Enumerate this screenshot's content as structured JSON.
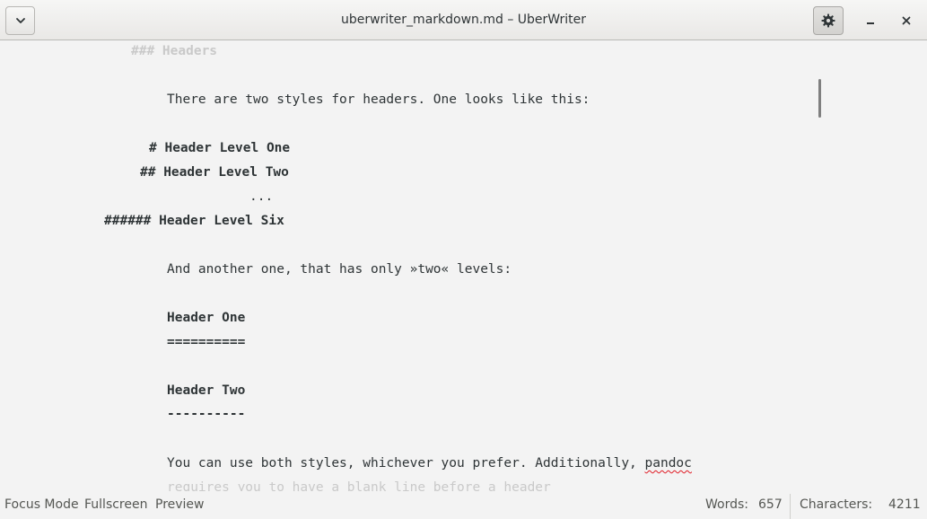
{
  "window": {
    "title": "uberwriter_markdown.md – UberWriter",
    "menu_icon": "chevron-down-icon",
    "settings_icon": "gear-icon",
    "minimize_icon": "minimize-icon",
    "close_icon": "close-icon"
  },
  "editor": {
    "lines": {
      "h3_partial": "### Headers",
      "para1": "There are two styles for headers. One looks like this:",
      "h1_marker": "#",
      "h1_text": "Header Level One",
      "h2_marker": "##",
      "h2_text": "Header Level Two",
      "ellipsis": "...",
      "h6_marker": "######",
      "h6_text": "Header Level Six",
      "para2": "And another one, that has only »two« levels:",
      "setext1_text": "Header One",
      "setext1_underline": "==========",
      "setext2_text": "Header Two",
      "setext2_underline": "----------",
      "para3_before": "You can use both styles, whichever you prefer. Additionally, ",
      "para3_misspelled": "pandoc",
      "para4_partial": "requires you to have a blank line before a header"
    }
  },
  "statusbar": {
    "focus_mode": "Focus Mode",
    "fullscreen": "Fullscreen",
    "preview": "Preview",
    "words_label": "Words:",
    "words_value": "657",
    "characters_label": "Characters:",
    "characters_value": "4211"
  },
  "colors": {
    "background": "#f3f3f3",
    "text": "#2e3436",
    "faded_text": "#9a9a9a",
    "spellcheck_underline": "#e01b24"
  }
}
